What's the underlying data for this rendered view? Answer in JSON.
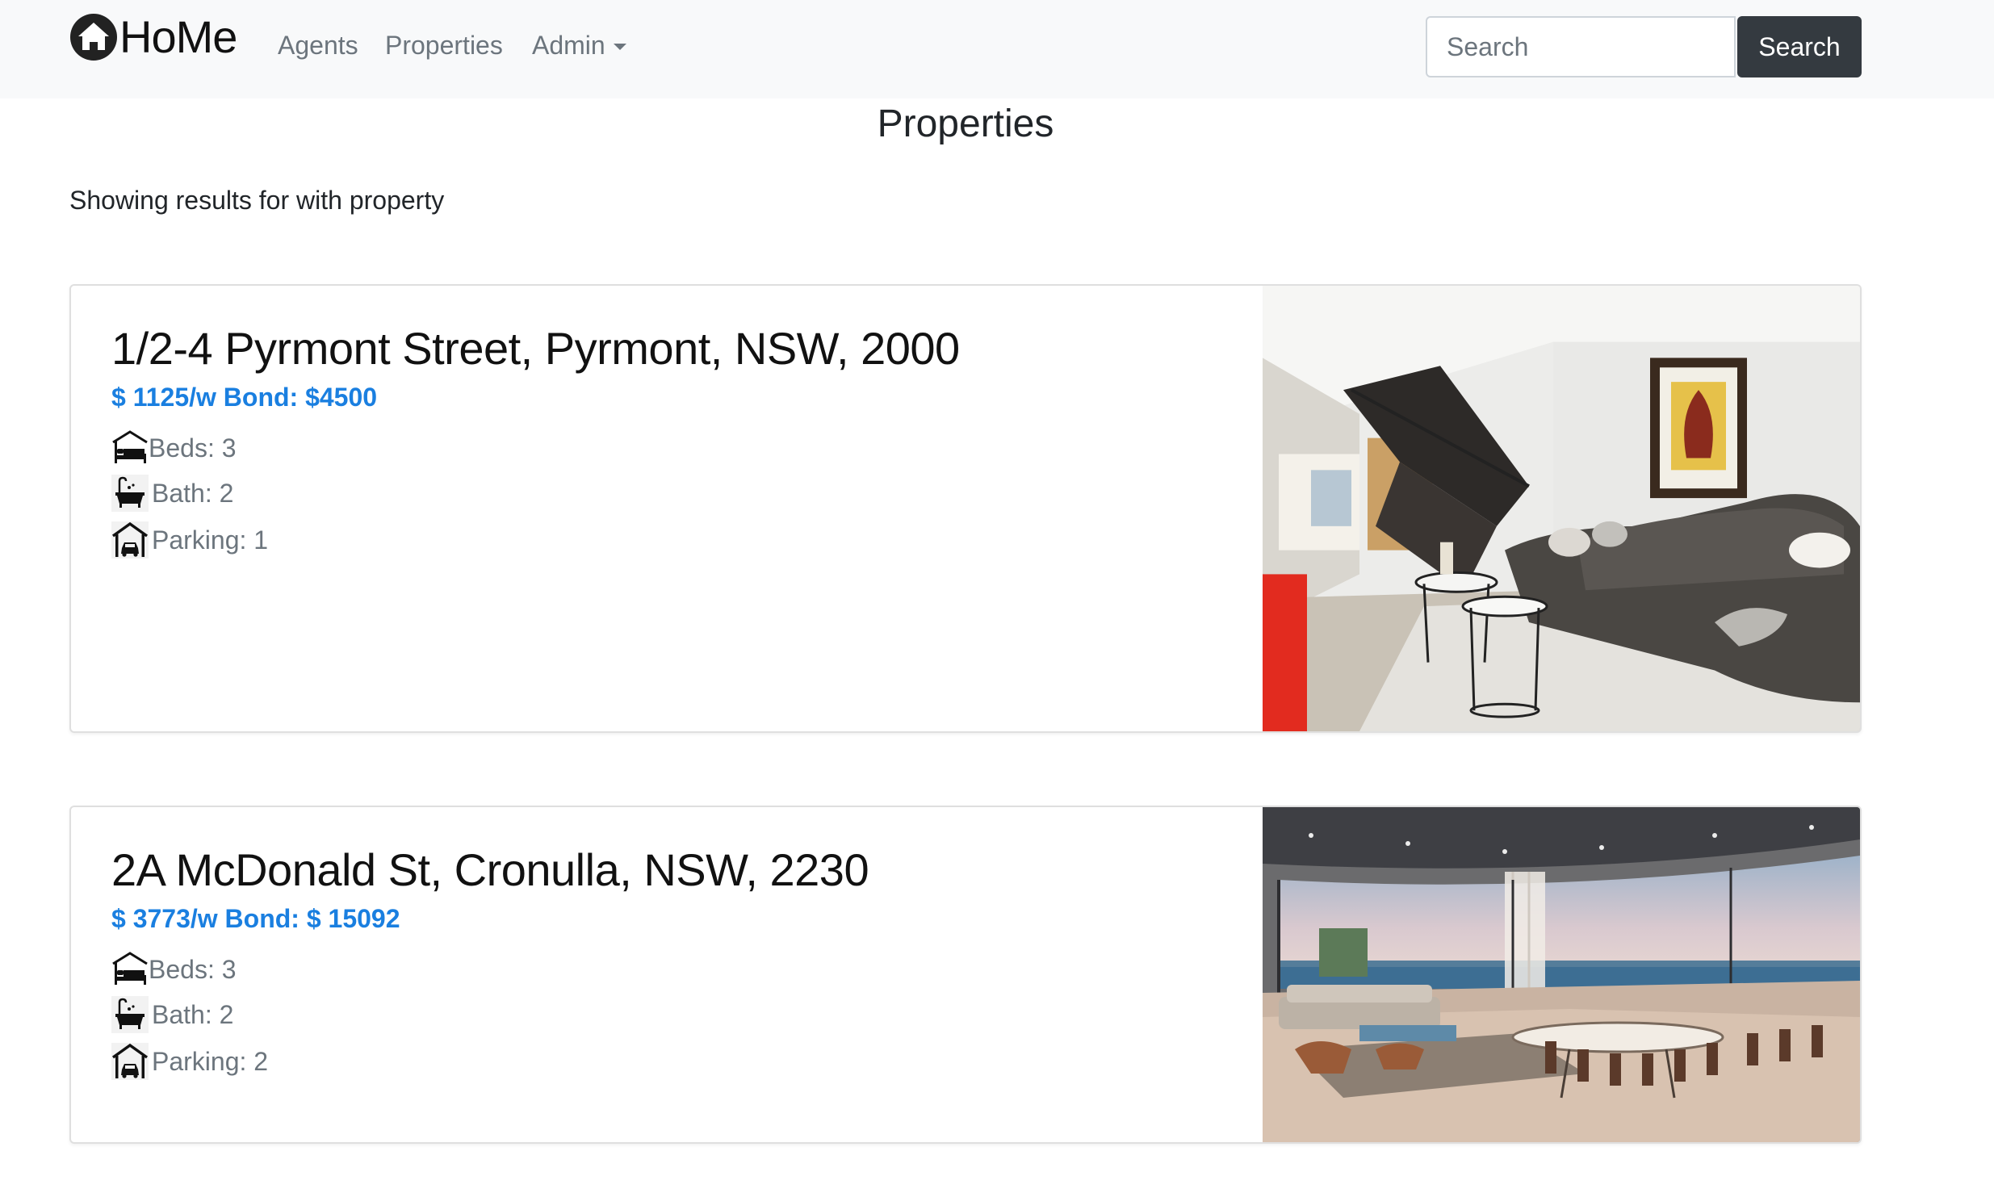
{
  "brand": {
    "name": "HoMe",
    "icon": "house-icon"
  },
  "nav": {
    "agents": "Agents",
    "properties": "Properties",
    "admin": "Admin"
  },
  "search": {
    "placeholder": "Search",
    "button_label": "Search"
  },
  "page": {
    "title": "Properties",
    "results_text": "Showing results for with property"
  },
  "listings": [
    {
      "address": "1/2-4 Pyrmont Street, Pyrmont, NSW, 2000",
      "price": "$ 1125/w Bond: $4500",
      "beds": "Beds: 3",
      "bath": "Bath: 2",
      "parking": "Parking: 1",
      "image": "living-room-photo"
    },
    {
      "address": "2A McDonald St, Cronulla, NSW, 2230",
      "price": "$ 3773/w Bond: $ 15092",
      "beds": "Beds: 3",
      "bath": "Bath: 2",
      "parking": "Parking: 2",
      "image": "ocean-view-living-photo"
    }
  ],
  "colors": {
    "navbar_bg": "#f8f9fa",
    "price": "#1a7fe0",
    "button_dark": "#343a40",
    "muted": "#6c757d"
  }
}
